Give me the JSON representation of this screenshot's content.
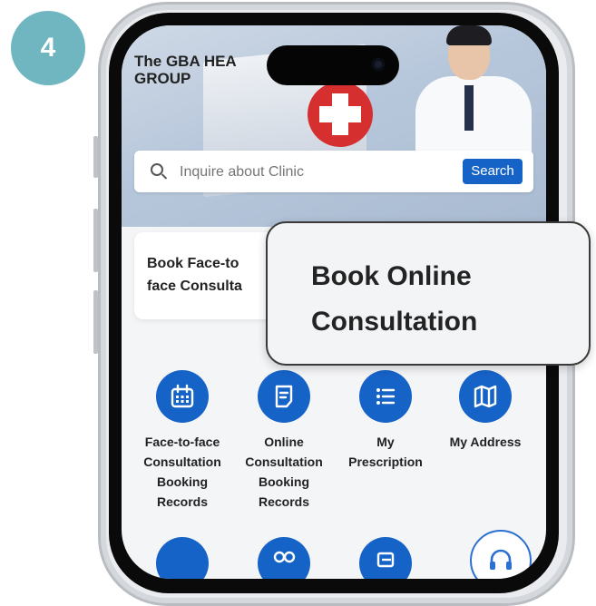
{
  "step": {
    "number": "4"
  },
  "header": {
    "brand_line1": "The GBA HEA",
    "brand_line2": "GROUP"
  },
  "search": {
    "placeholder": "Inquire about Clinic",
    "button_label": "Search"
  },
  "card": {
    "title_line1": "Book Face-to",
    "title_line2": "face Consulta"
  },
  "callout": {
    "title_line1": "Book Online",
    "title_line2": "Consultation"
  },
  "grid": {
    "items": [
      {
        "icon": "calendar-icon",
        "lines": [
          "Face-to-face",
          "Consultation",
          "Booking",
          "Records"
        ]
      },
      {
        "icon": "document-icon",
        "lines": [
          "Online",
          "Consultation",
          "Booking",
          "Records"
        ]
      },
      {
        "icon": "list-icon",
        "lines": [
          "My",
          "Prescription"
        ]
      },
      {
        "icon": "map-icon",
        "lines": [
          "My Address"
        ]
      }
    ]
  },
  "colors": {
    "accent": "#1663c7",
    "badge": "#6fb6c0",
    "cross": "#d62f2f"
  }
}
